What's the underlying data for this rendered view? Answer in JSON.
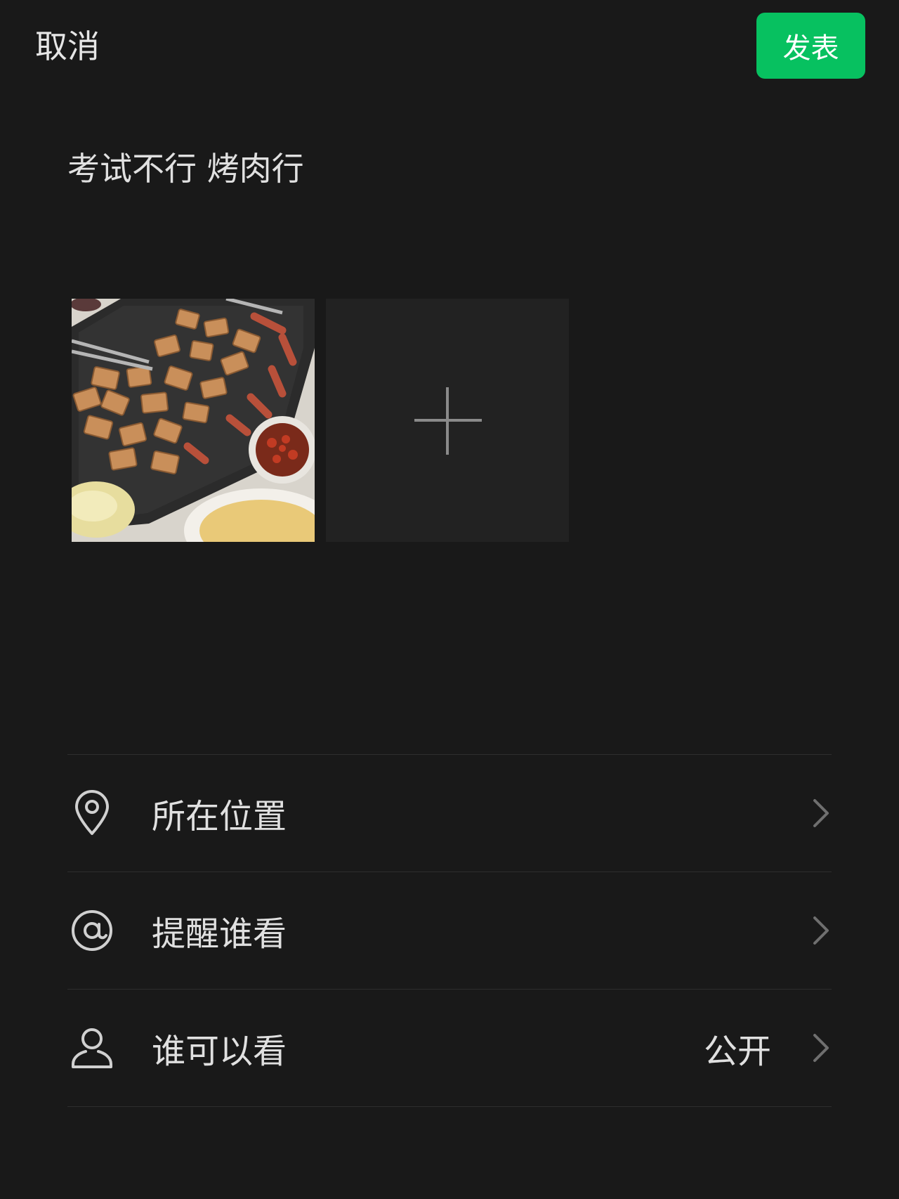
{
  "header": {
    "cancel_label": "取消",
    "publish_label": "发表",
    "publish_color": "#07c160"
  },
  "post": {
    "text": "考试不行 烤肉行",
    "images": [
      {
        "icon": "photo-thumbnail",
        "description_visible": false
      }
    ],
    "add_image_icon": "plus-icon"
  },
  "options": [
    {
      "icon": "location-pin-icon",
      "label": "所在位置",
      "value": ""
    },
    {
      "icon": "at-sign-icon",
      "label": "提醒谁看",
      "value": ""
    },
    {
      "icon": "person-icon",
      "label": "谁可以看",
      "value": "公开"
    }
  ],
  "theme": {
    "background": "#191919",
    "text": "#e0e0e0",
    "divider": "#2e2e2e",
    "chevron": "#6f6f6f"
  }
}
